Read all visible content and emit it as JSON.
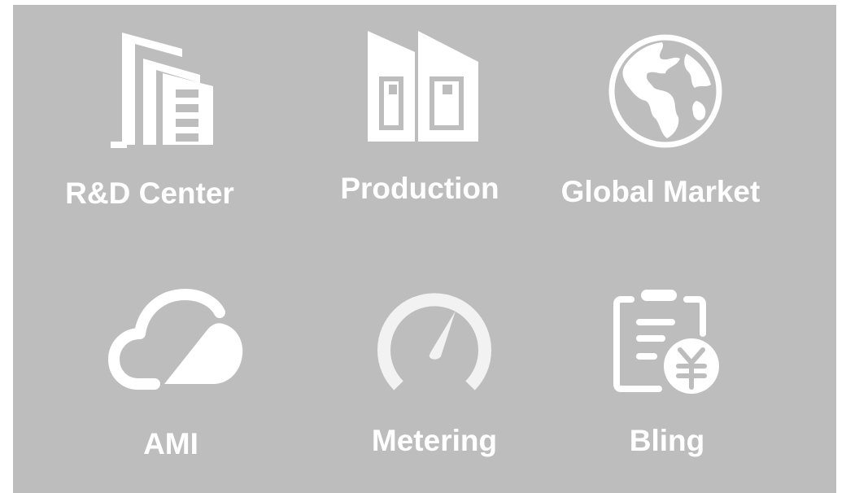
{
  "menu": {
    "items": [
      {
        "label": "R&D Center",
        "icon": "building-icon"
      },
      {
        "label": "Production",
        "icon": "factory-icon"
      },
      {
        "label": "Global Market",
        "icon": "globe-icon"
      },
      {
        "label": "AMI",
        "icon": "cloud-icon"
      },
      {
        "label": "Metering",
        "icon": "speedometer-icon"
      },
      {
        "label": "Bling",
        "icon": "invoice-yen-icon"
      }
    ]
  },
  "colors": {
    "panel_background": "#bdbdbd",
    "icon": "#ffffff",
    "icon_soft": "#f2f2f2",
    "label": "#ffffff"
  }
}
